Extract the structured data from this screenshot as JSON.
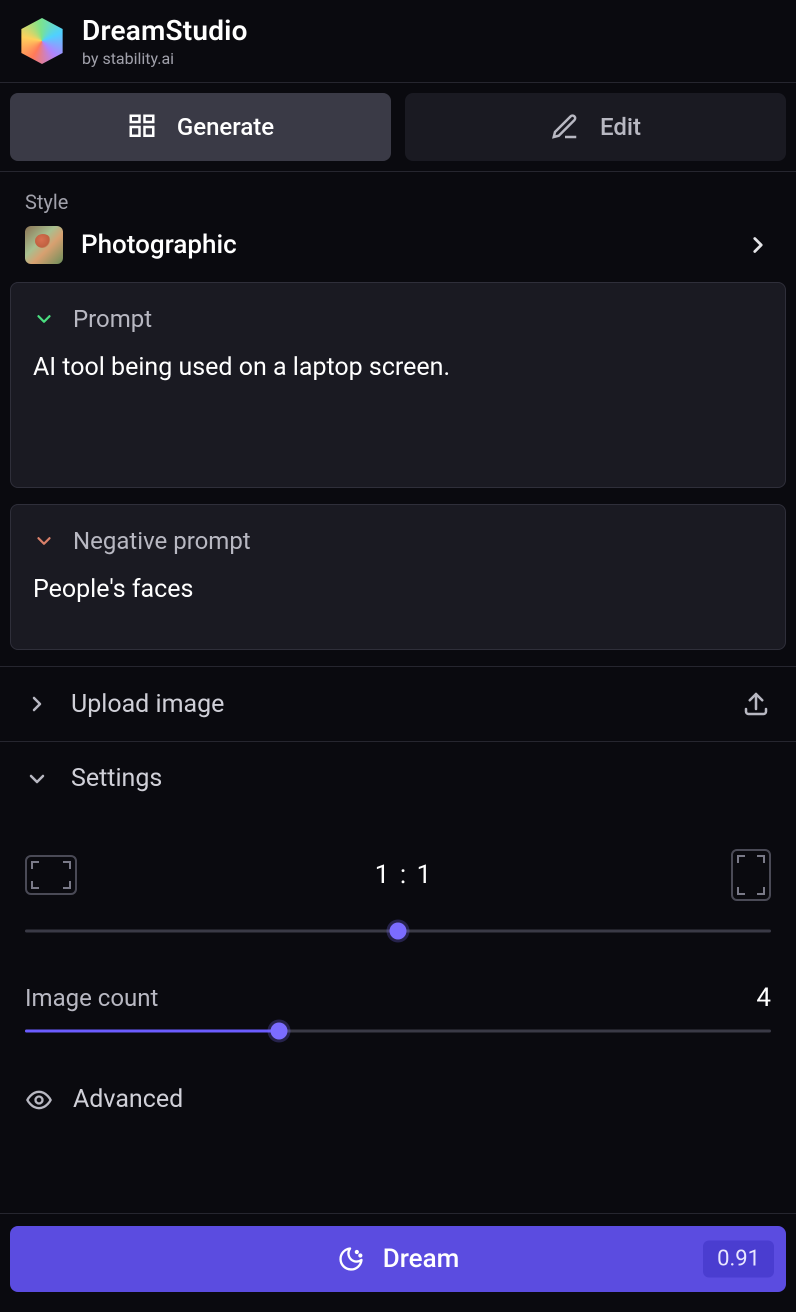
{
  "brand": {
    "title": "DreamStudio",
    "subtitle": "by stability.ai"
  },
  "tabs": {
    "generate": "Generate",
    "edit": "Edit"
  },
  "style": {
    "label": "Style",
    "selected": "Photographic"
  },
  "prompt": {
    "label": "Prompt",
    "text": "AI tool being used on a laptop screen."
  },
  "negative": {
    "label": "Negative prompt",
    "text": "People's faces"
  },
  "upload": {
    "label": "Upload image"
  },
  "settings": {
    "label": "Settings",
    "ratio": "1 : 1",
    "ratio_slider_percent": 50,
    "image_count_label": "Image count",
    "image_count_value": "4",
    "image_count_percent": 34,
    "advanced_label": "Advanced"
  },
  "action": {
    "label": "Dream",
    "cost": "0.91"
  }
}
